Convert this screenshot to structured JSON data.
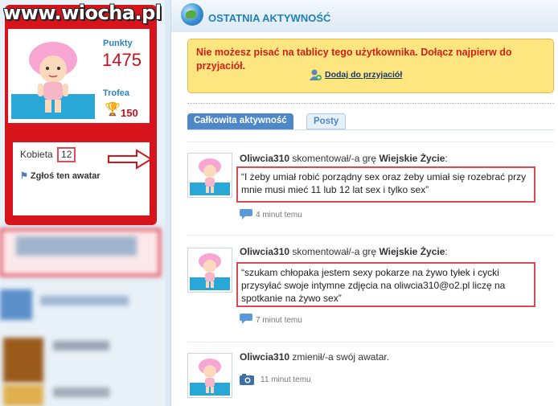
{
  "watermark": "www.wiocha.pl",
  "profile": {
    "points_label": "Punkty",
    "points_value": "1475",
    "trophies_label": "Trofea",
    "trophies_count": "150",
    "gender": "Kobieta",
    "age": "12",
    "report_link": "Zgłoś ten awatar"
  },
  "activity": {
    "title": "OSTATNIA AKTYWNOŚĆ",
    "warning": "Nie możesz pisać na tablicy tego użytkownika. Dołącz najpierw do przyjaciół.",
    "add_friend": "Dodaj do przyjaciół",
    "tabs": [
      "Całkowita aktywność",
      "Posty"
    ],
    "items": [
      {
        "user": "Oliwcia310",
        "action": " skomentował/-a grę ",
        "game": "Wiejskie Życie",
        "suffix": ":",
        "quote": "“I żeby umiał robić porządny sex oraz żeby umiał się rozebrać przy mnie musi mieć 11 lub 12 lat sex i tylko sex”",
        "time": "4 minut temu",
        "icon": "comment-icon"
      },
      {
        "user": "Oliwcia310",
        "action": " skomentował/-a grę ",
        "game": "Wiejskie Życie",
        "suffix": ":",
        "quote": "“szukam chłopaka jestem sexy pokarze na żywo tyłek i cycki przysyłać swoje intymne zdjęcia na oliwcia310@o2.pl liczę na spotkanie na żywo sex”",
        "time": "7 minut temu",
        "icon": "comment-icon"
      },
      {
        "user": "Oliwcia310",
        "action": " zmienił/-a swój awatar.",
        "time": "11 minut temu",
        "icon": "camera-icon"
      }
    ]
  },
  "colors": {
    "brand_red": "#d7141c",
    "link_blue": "#1f7fb8",
    "warning_bg": "#fde680",
    "highlight_border": "#d94a55"
  }
}
